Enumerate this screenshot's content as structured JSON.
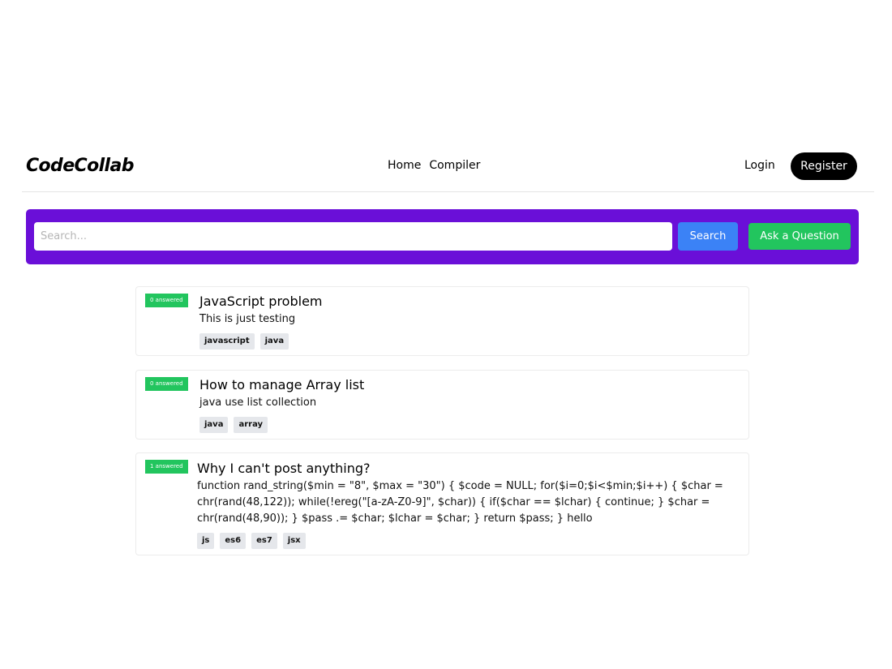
{
  "header": {
    "logo": "CodeCollab",
    "nav": [
      {
        "label": "Home"
      },
      {
        "label": "Compiler"
      }
    ],
    "login_label": "Login",
    "register_label": "Register"
  },
  "search": {
    "placeholder": "Search...",
    "value": "",
    "search_button": "Search",
    "ask_button": "Ask a Question"
  },
  "questions": [
    {
      "badge": "0 answered",
      "title": "JavaScript problem",
      "body": "This is just testing",
      "tags": [
        "javascript",
        "java"
      ]
    },
    {
      "badge": "0 answered",
      "title": "How to manage Array list",
      "body": "java use list collection",
      "tags": [
        "java",
        "array"
      ]
    },
    {
      "badge": "1 answered",
      "title": "Why I can't post anything?",
      "body": "function rand_string($min = \"8\", $max = \"30\") { $code = NULL; for($i=0;$i<$min;$i++) { $char = chr(rand(48,122)); while(!ereg(\"[a-zA-Z0-9]\", $char)) { if($char == $lchar) { continue; } $char = chr(rand(48,90)); } $pass .= $char; $lchar = $char; } return $pass; } hello",
      "tags": [
        "js",
        "es6",
        "es7",
        "jsx"
      ]
    }
  ],
  "colors": {
    "search_panel": "#6a0fd8",
    "search_button": "#3b82f6",
    "ask_button": "#22c55e",
    "answered_badge": "#22c55e",
    "register_button": "#000000"
  }
}
